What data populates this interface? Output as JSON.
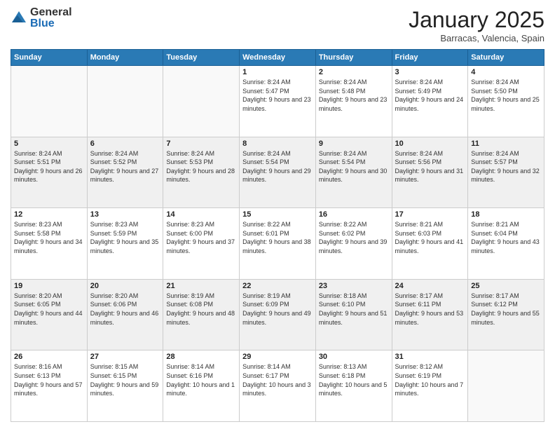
{
  "logo": {
    "general": "General",
    "blue": "Blue"
  },
  "header": {
    "month": "January 2025",
    "location": "Barracas, Valencia, Spain"
  },
  "weekdays": [
    "Sunday",
    "Monday",
    "Tuesday",
    "Wednesday",
    "Thursday",
    "Friday",
    "Saturday"
  ],
  "weeks": [
    [
      {
        "day": "",
        "info": ""
      },
      {
        "day": "",
        "info": ""
      },
      {
        "day": "",
        "info": ""
      },
      {
        "day": "1",
        "info": "Sunrise: 8:24 AM\nSunset: 5:47 PM\nDaylight: 9 hours and 23 minutes."
      },
      {
        "day": "2",
        "info": "Sunrise: 8:24 AM\nSunset: 5:48 PM\nDaylight: 9 hours and 23 minutes."
      },
      {
        "day": "3",
        "info": "Sunrise: 8:24 AM\nSunset: 5:49 PM\nDaylight: 9 hours and 24 minutes."
      },
      {
        "day": "4",
        "info": "Sunrise: 8:24 AM\nSunset: 5:50 PM\nDaylight: 9 hours and 25 minutes."
      }
    ],
    [
      {
        "day": "5",
        "info": "Sunrise: 8:24 AM\nSunset: 5:51 PM\nDaylight: 9 hours and 26 minutes."
      },
      {
        "day": "6",
        "info": "Sunrise: 8:24 AM\nSunset: 5:52 PM\nDaylight: 9 hours and 27 minutes."
      },
      {
        "day": "7",
        "info": "Sunrise: 8:24 AM\nSunset: 5:53 PM\nDaylight: 9 hours and 28 minutes."
      },
      {
        "day": "8",
        "info": "Sunrise: 8:24 AM\nSunset: 5:54 PM\nDaylight: 9 hours and 29 minutes."
      },
      {
        "day": "9",
        "info": "Sunrise: 8:24 AM\nSunset: 5:54 PM\nDaylight: 9 hours and 30 minutes."
      },
      {
        "day": "10",
        "info": "Sunrise: 8:24 AM\nSunset: 5:56 PM\nDaylight: 9 hours and 31 minutes."
      },
      {
        "day": "11",
        "info": "Sunrise: 8:24 AM\nSunset: 5:57 PM\nDaylight: 9 hours and 32 minutes."
      }
    ],
    [
      {
        "day": "12",
        "info": "Sunrise: 8:23 AM\nSunset: 5:58 PM\nDaylight: 9 hours and 34 minutes."
      },
      {
        "day": "13",
        "info": "Sunrise: 8:23 AM\nSunset: 5:59 PM\nDaylight: 9 hours and 35 minutes."
      },
      {
        "day": "14",
        "info": "Sunrise: 8:23 AM\nSunset: 6:00 PM\nDaylight: 9 hours and 37 minutes."
      },
      {
        "day": "15",
        "info": "Sunrise: 8:22 AM\nSunset: 6:01 PM\nDaylight: 9 hours and 38 minutes."
      },
      {
        "day": "16",
        "info": "Sunrise: 8:22 AM\nSunset: 6:02 PM\nDaylight: 9 hours and 39 minutes."
      },
      {
        "day": "17",
        "info": "Sunrise: 8:21 AM\nSunset: 6:03 PM\nDaylight: 9 hours and 41 minutes."
      },
      {
        "day": "18",
        "info": "Sunrise: 8:21 AM\nSunset: 6:04 PM\nDaylight: 9 hours and 43 minutes."
      }
    ],
    [
      {
        "day": "19",
        "info": "Sunrise: 8:20 AM\nSunset: 6:05 PM\nDaylight: 9 hours and 44 minutes."
      },
      {
        "day": "20",
        "info": "Sunrise: 8:20 AM\nSunset: 6:06 PM\nDaylight: 9 hours and 46 minutes."
      },
      {
        "day": "21",
        "info": "Sunrise: 8:19 AM\nSunset: 6:08 PM\nDaylight: 9 hours and 48 minutes."
      },
      {
        "day": "22",
        "info": "Sunrise: 8:19 AM\nSunset: 6:09 PM\nDaylight: 9 hours and 49 minutes."
      },
      {
        "day": "23",
        "info": "Sunrise: 8:18 AM\nSunset: 6:10 PM\nDaylight: 9 hours and 51 minutes."
      },
      {
        "day": "24",
        "info": "Sunrise: 8:17 AM\nSunset: 6:11 PM\nDaylight: 9 hours and 53 minutes."
      },
      {
        "day": "25",
        "info": "Sunrise: 8:17 AM\nSunset: 6:12 PM\nDaylight: 9 hours and 55 minutes."
      }
    ],
    [
      {
        "day": "26",
        "info": "Sunrise: 8:16 AM\nSunset: 6:13 PM\nDaylight: 9 hours and 57 minutes."
      },
      {
        "day": "27",
        "info": "Sunrise: 8:15 AM\nSunset: 6:15 PM\nDaylight: 9 hours and 59 minutes."
      },
      {
        "day": "28",
        "info": "Sunrise: 8:14 AM\nSunset: 6:16 PM\nDaylight: 10 hours and 1 minute."
      },
      {
        "day": "29",
        "info": "Sunrise: 8:14 AM\nSunset: 6:17 PM\nDaylight: 10 hours and 3 minutes."
      },
      {
        "day": "30",
        "info": "Sunrise: 8:13 AM\nSunset: 6:18 PM\nDaylight: 10 hours and 5 minutes."
      },
      {
        "day": "31",
        "info": "Sunrise: 8:12 AM\nSunset: 6:19 PM\nDaylight: 10 hours and 7 minutes."
      },
      {
        "day": "",
        "info": ""
      }
    ]
  ]
}
